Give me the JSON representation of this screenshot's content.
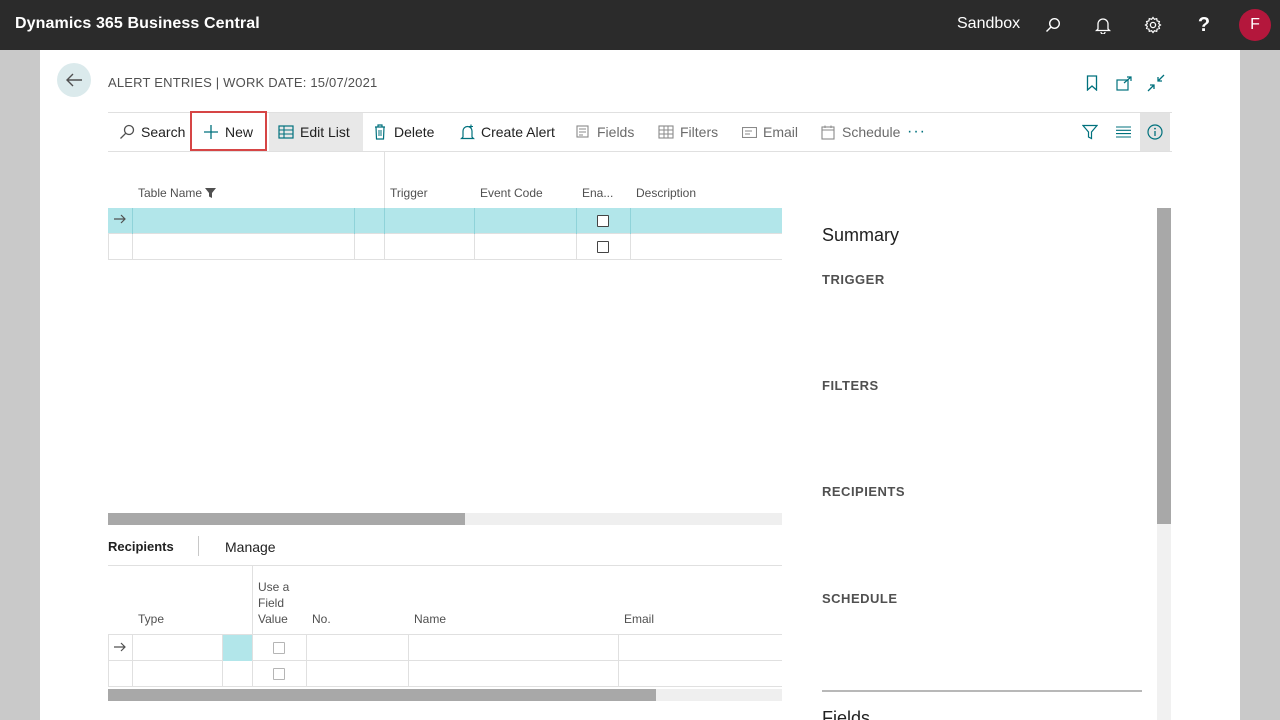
{
  "app": {
    "title": "Dynamics 365 Business Central",
    "environment": "Sandbox",
    "user_initial": "F",
    "icons": [
      "search-icon",
      "bell-icon",
      "gear-icon",
      "help-icon"
    ]
  },
  "page": {
    "title": "ALERT ENTRIES | WORK DATE: 15/07/2021"
  },
  "actions": {
    "search": "Search",
    "new": "New",
    "edit_list": "Edit List",
    "delete": "Delete",
    "create_alert": "Create Alert",
    "fields": "Fields",
    "filters": "Filters",
    "email": "Email",
    "schedule": "Schedule",
    "more": "···"
  },
  "list": {
    "columns": [
      "Table Name",
      "Trigger",
      "Event Code",
      "Ena...",
      "Description"
    ],
    "rows": [
      {
        "table_name": "",
        "trigger": "",
        "event_code": "",
        "enabled": false,
        "description": "",
        "selected": true
      },
      {
        "table_name": "",
        "trigger": "",
        "event_code": "",
        "enabled": false,
        "description": "",
        "selected": false
      }
    ],
    "scroll_fraction": 0.53
  },
  "subpage": {
    "tabs": [
      "Recipients",
      "Manage"
    ],
    "columns": {
      "type": "Type",
      "use_field_value_1": "Use a",
      "use_field_value_2": "Field",
      "use_field_value_3": "Value",
      "no": "No.",
      "name": "Name",
      "email": "Email"
    },
    "scroll_fraction": 0.81
  },
  "factbox": {
    "title": "Summary",
    "labels": [
      "TRIGGER",
      "FILTERS",
      "RECIPIENTS",
      "SCHEDULE"
    ],
    "fields_label": "Fields"
  },
  "colors": {
    "topbar": "#2b2b2b",
    "accent": "#00717d",
    "selected_row": "#b2e6ea",
    "highlight_box": "#d64545",
    "avatar": "#b4173c"
  }
}
